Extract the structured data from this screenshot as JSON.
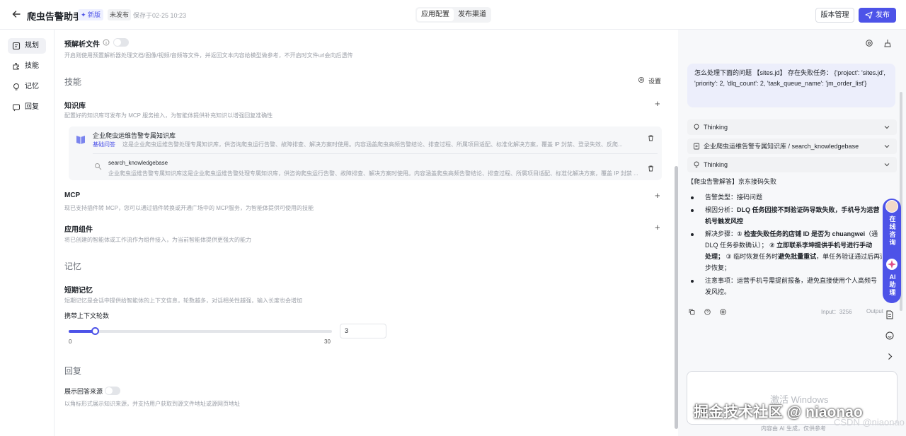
{
  "header": {
    "title": "爬虫告警助手",
    "badge_new": "✦ 新版",
    "badge_unpublished": "未发布",
    "saved_at": "保存于02-25 10:23",
    "tab_app_config": "应用配置",
    "tab_publish_channel": "发布渠道",
    "version_button": "版本管理",
    "publish_button": "发布"
  },
  "nav": {
    "items": [
      {
        "label": "规划"
      },
      {
        "label": "技能"
      },
      {
        "label": "记忆"
      },
      {
        "label": "回复"
      }
    ]
  },
  "main": {
    "preparse_label": "预解析文件",
    "preparse_desc": "开启则使用预置解析器处理文档/图像/视频/音频等文件，并返回文本内容给模型做参考，不开启时文件url会向后透传",
    "skills_heading": "技能",
    "skills_settings": "设置",
    "kb_label": "知识库",
    "kb_desc": "配置好的知识库可发布为 MCP 服务接入，为智能体提供补充知识以增强回复准确性",
    "kb_item_name": "企业爬虫运维告警专属知识库",
    "kb_item_tag": "基础问答",
    "kb_item_desc": "这是企业爬虫运维告警处理专属知识库，供咨询爬虫运行告警、故障排查、解决方案时使用。内容涵盖爬虫高频告警结论、排查过程、所属项目适配、标准化解决方案，覆盖 IP 封禁、登录失效、反爬...",
    "kb_tool_name": "search_knowledgebase",
    "kb_tool_desc": "企业爬虫运维告警专属知识库这是企业爬虫运维告警处理专属知识库，供咨询爬虫运行告警、故障排查、解决方案时使用。内容涵盖爬虫高频告警结论、排查过程、所属项目适配、标准化解决方案，覆盖 IP 封禁 ...",
    "mcp_label": "MCP",
    "mcp_desc": "现已支持插件转 MCP，您可以通过插件转换或开通广场中的 MCP服务，为智能体提供可使用的技能",
    "component_label": "应用组件",
    "component_desc": "将已创建的智能体或工作流作为组件接入，为当前智能体提供更强大的能力",
    "memory_heading": "记忆",
    "short_mem_label": "短期记忆",
    "short_mem_desc": "短期记忆是会话中提供给智能体的上下文信息，轮数越多，对话相关性越强，输入长度也会增加",
    "context_rounds_label": "携带上下文轮数",
    "slider_min": "0",
    "slider_max": "30",
    "slider_value": "3",
    "slider_fraction": 0.1,
    "reply_heading": "回复",
    "show_source_label": "展示回答来源",
    "show_source_desc": "以角标形式展示知识来源，并支持用户获取到源文件地址或源网页地址"
  },
  "chat": {
    "user_message": "怎么处理下面的问题 【sites.jd】 存在失败任务： {'project': 'sites.jd', 'priority': 2, 'dlq_count': 2, 'task_queue_name': 'jm_order_list'}",
    "thinking1": "Thinking",
    "tool_call": "企业爬虫运维告警专属知识库 / search_knowledgebase",
    "thinking2": "Thinking",
    "answer_title": "【爬虫告警解答】京东接码失败",
    "b1": "告警类型：接码问题",
    "b2_pre": "根因分析：",
    "b2_bold": "DLQ 任务因接不到验证码导致失败，手机号为运营",
    "b2_line2": "机号触发风控",
    "b3_pre": "解决步骤：",
    "b3_bold": "① 检查失败任务的店铺 ID 是否为 chuangwei",
    "b3_tail": "（通",
    "b3_line2_pre": "DLQ 任务参数确认）；",
    "b3_line2_bold": "② 立即联系李坤提供手机号进行手动",
    "b3_line3_bold": "处理；",
    "b3_line3_mid": "③ 临时恢复任务时",
    "b3_line3_bold2": "避免批量重试",
    "b3_line3_tail": "，单任务验证通过后再逐",
    "b3_line4": "步恢复；",
    "b4_pre": "注意事项：运营手机号需提前报备，避免直接使用个人高频号",
    "b4_line2": "发风控。",
    "input_tokens": "Input：3256",
    "output_tokens": "Output",
    "ai_note": "内容由 AI 生成，仅供参考",
    "float_consult": "在线咨询",
    "float_ai": "AI助理",
    "win_watermark": "激活 Windows",
    "juejin_watermark": "掘金技术社区 @ niaonao",
    "csdn_watermark": "CSDN @niaonao"
  }
}
